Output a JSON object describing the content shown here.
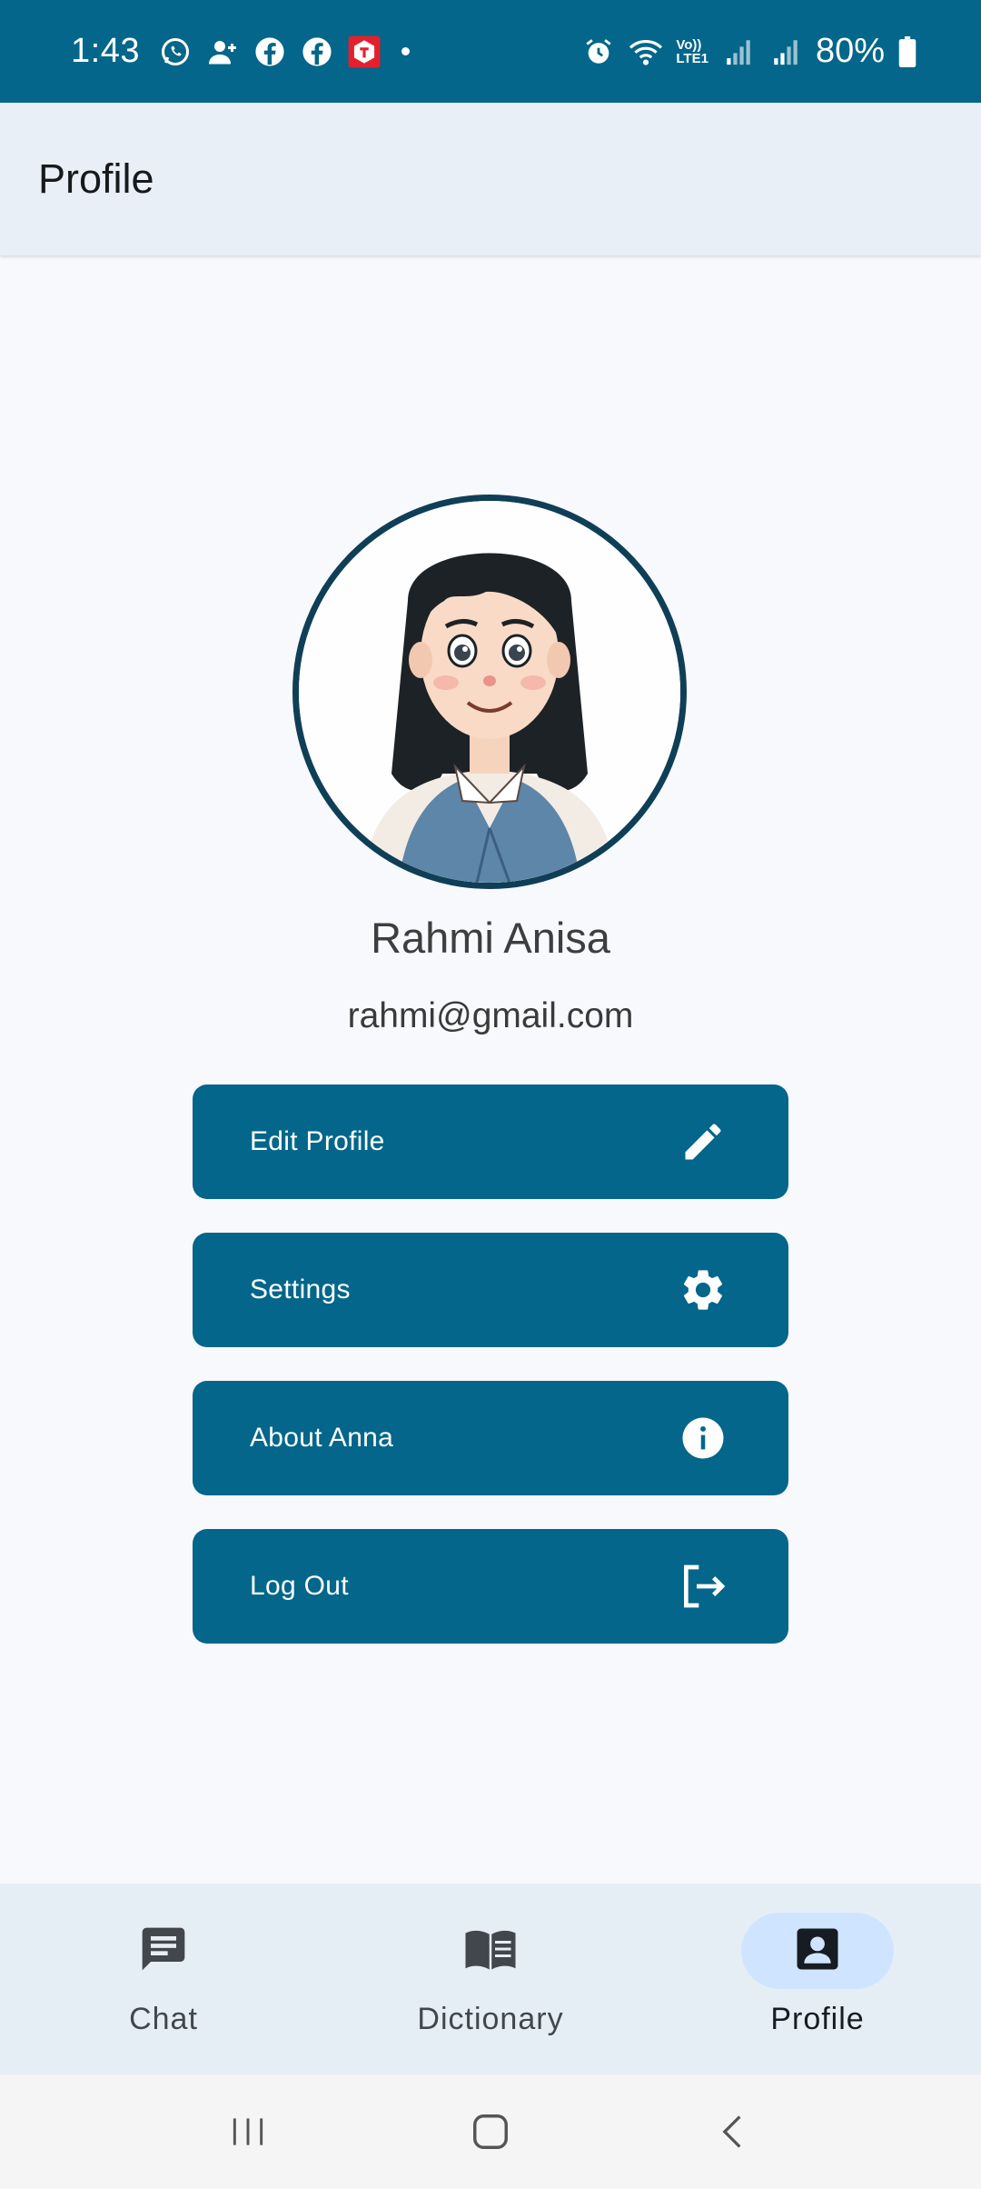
{
  "status_bar": {
    "time": "1:43",
    "battery": "80%",
    "left_icons": [
      "whatsapp-icon",
      "contact-add-icon",
      "facebook-icon",
      "facebook-icon",
      "telkomsel-icon"
    ],
    "right_icons": [
      "alarm-icon",
      "wifi-icon",
      "volte-icon",
      "signal-icon",
      "signal-icon",
      "battery-icon"
    ],
    "network_label_top": "Vo))",
    "network_label_bottom": "LTE1"
  },
  "app_bar": {
    "title": "Profile"
  },
  "profile": {
    "name": "Rahmi Anisa",
    "email": "rahmi@gmail.com"
  },
  "menu": [
    {
      "label": "Edit Profile",
      "icon": "pencil-icon"
    },
    {
      "label": "Settings",
      "icon": "gear-icon"
    },
    {
      "label": "About Anna",
      "icon": "info-icon"
    },
    {
      "label": "Log Out",
      "icon": "logout-icon"
    }
  ],
  "bottom_nav": {
    "items": [
      {
        "label": "Chat",
        "icon": "chat-icon",
        "active": false
      },
      {
        "label": "Dictionary",
        "icon": "book-icon",
        "active": false
      },
      {
        "label": "Profile",
        "icon": "profile-icon",
        "active": true
      }
    ]
  },
  "system_nav": [
    "recents-icon",
    "home-icon",
    "back-icon"
  ],
  "colors": {
    "primary": "#03668a",
    "app_bar_bg": "#e8eff6",
    "page_bg": "#f8f9fd",
    "nav_active_pill": "#cfe5ff",
    "avatar_border": "#0f3f57"
  }
}
